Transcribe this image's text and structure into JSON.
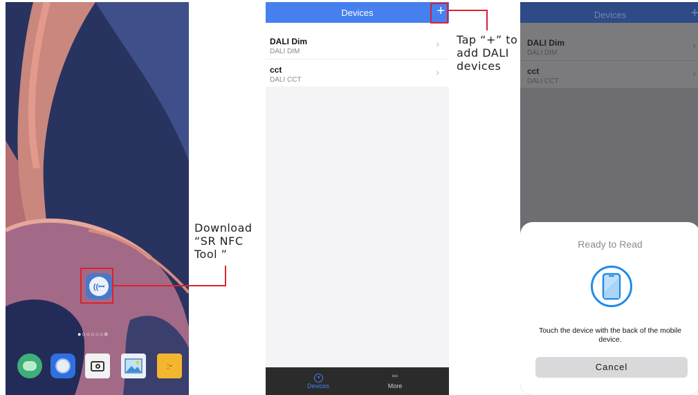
{
  "home": {
    "app_icon": "nfc-tool-icon",
    "page_dots": "●○○○○○≡",
    "dock_icons": [
      "messages-icon",
      "browser-icon",
      "camera-icon",
      "gallery-icon",
      "notes-icon"
    ]
  },
  "callouts": {
    "download_line1": "Download",
    "download_line2": "“SR NFC",
    "download_line3": "Tool ”",
    "tap_line1": "Tap “+” to",
    "tap_line2": "add DALI",
    "tap_line3": "devices",
    "color": "#d9232e"
  },
  "app": {
    "header_title": "Devices",
    "add_icon": "+",
    "devices": [
      {
        "name": "DALI Dim",
        "type": "DALI DIM"
      },
      {
        "name": "cct",
        "type": "DALI CCT"
      }
    ],
    "tabs": {
      "devices_label": "Devices",
      "more_label": "More"
    },
    "accent": "#4680ee"
  },
  "nfc_sheet": {
    "title": "Ready to Read",
    "message": "Touch the device with the back of the mobile device.",
    "cancel_label": "Cancel",
    "icon": "phone-icon",
    "icon_color": "#1e8be8"
  }
}
